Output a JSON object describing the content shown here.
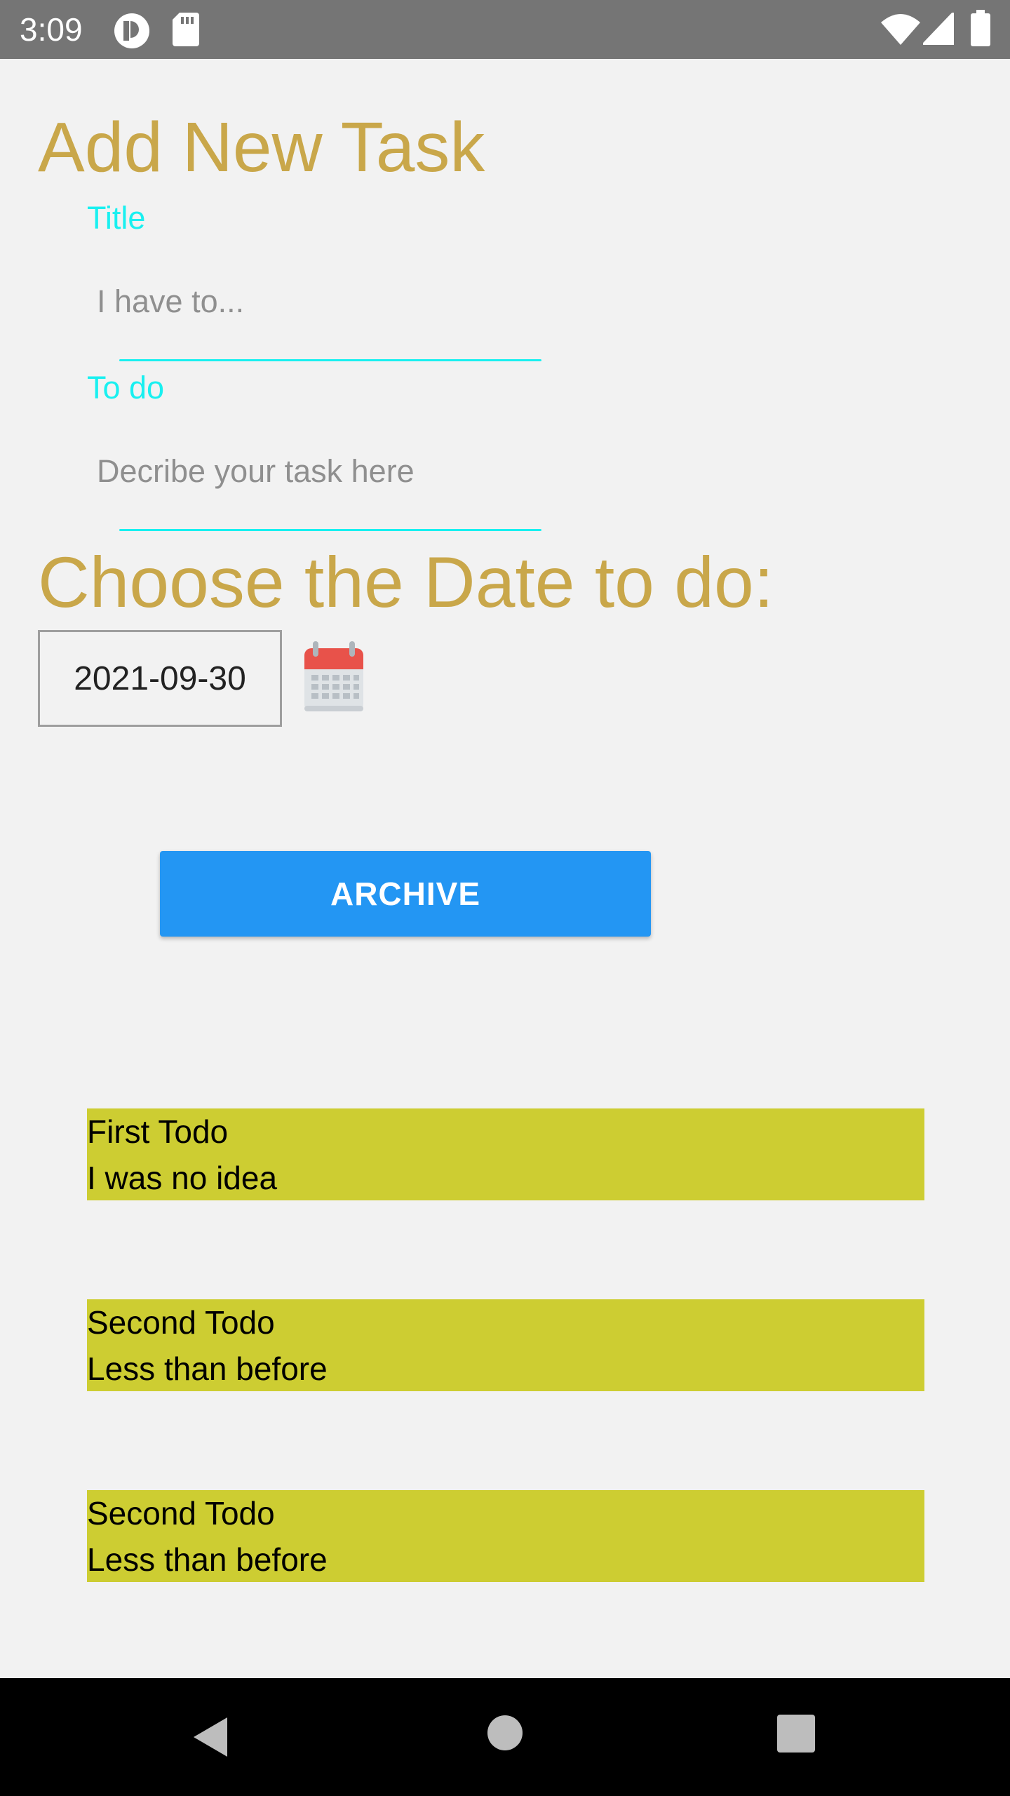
{
  "status_bar": {
    "time": "3:09",
    "icons": [
      "app-notification-icon",
      "sd-card-icon",
      "wifi-icon",
      "cell-signal-icon",
      "battery-icon"
    ]
  },
  "form": {
    "heading": "Add New Task",
    "title_label": "Title",
    "title_placeholder": "I have to...",
    "title_value": "",
    "todo_label": "To do",
    "todo_placeholder": "Decribe your task here",
    "todo_value": "",
    "date_heading": "Choose the Date to do:",
    "date_value": "2021-09-30",
    "calendar_icon": "calendar-icon",
    "archive_label": "ARCHIVE"
  },
  "todos": [
    {
      "title": "First Todo",
      "description": "I was no idea"
    },
    {
      "title": "Second Todo",
      "description": "Less than before"
    },
    {
      "title": "Second Todo",
      "description": "Less than before"
    }
  ],
  "nav_bar": {
    "icons": [
      "back-icon",
      "home-icon",
      "recents-icon"
    ]
  },
  "colors": {
    "heading": "#c9a74a",
    "field_label": "#19f0f0",
    "button": "#2396f3",
    "todo_card": "#cdcd32",
    "status_bar": "#757575",
    "nav_bar": "#000000",
    "background": "#f2f2f2"
  }
}
